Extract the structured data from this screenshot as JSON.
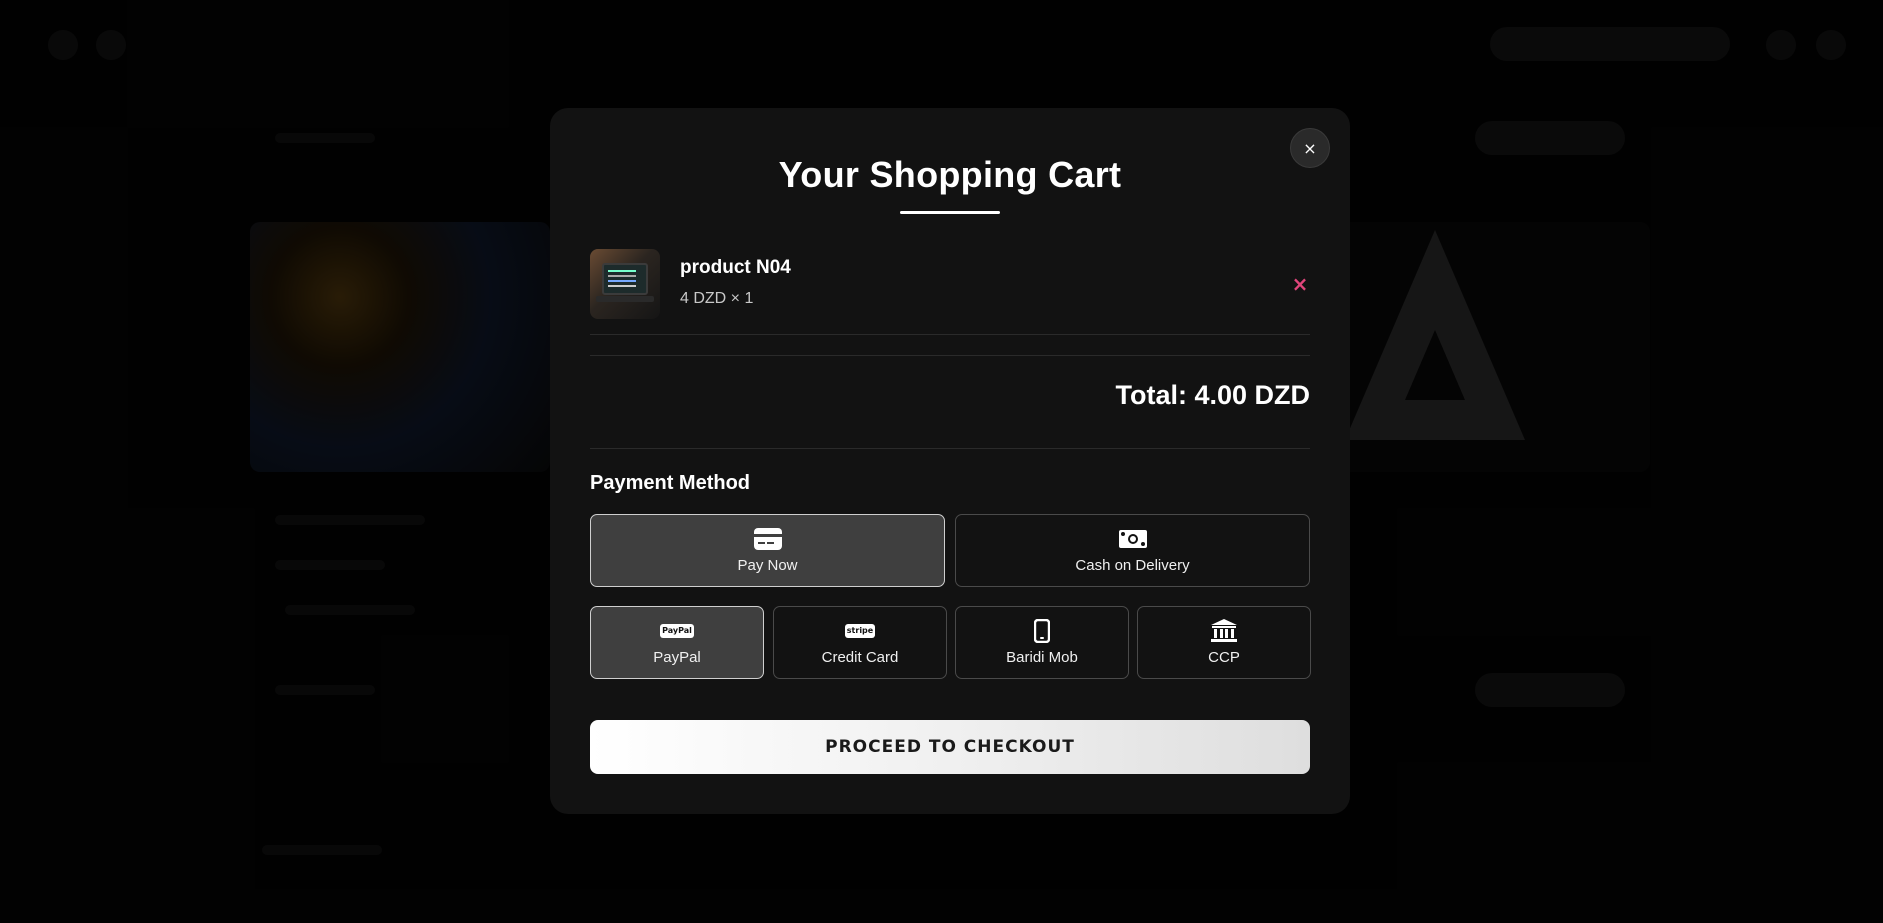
{
  "modal": {
    "title": "Your Shopping Cart",
    "close_glyph": "×"
  },
  "cart": {
    "items": [
      {
        "name": "product N04",
        "price_qty": "4 DZD × 1",
        "remove_glyph": "×"
      }
    ],
    "total": "Total: 4.00 DZD"
  },
  "payment": {
    "section_title": "Payment Method",
    "methods": [
      {
        "label": "Pay Now",
        "icon": "credit-card-icon",
        "selected": true
      },
      {
        "label": "Cash on Delivery",
        "icon": "cash-icon",
        "selected": false
      }
    ],
    "providers": [
      {
        "label": "PayPal",
        "icon": "paypal-logo",
        "logo_text": "PayPal",
        "selected": true
      },
      {
        "label": "Credit Card",
        "icon": "stripe-logo",
        "logo_text": "stripe",
        "selected": false
      },
      {
        "label": "Baridi Mob",
        "icon": "mobile-phone-icon",
        "selected": false
      },
      {
        "label": "CCP",
        "icon": "bank-icon",
        "selected": false
      }
    ]
  },
  "checkout": {
    "label": "PROCEED TO CHECKOUT"
  },
  "colors": {
    "modal_bg": "#121212",
    "selected_bg": "#3f3f3f",
    "remove_accent": "#e0457b",
    "page_bg": "#050505"
  }
}
